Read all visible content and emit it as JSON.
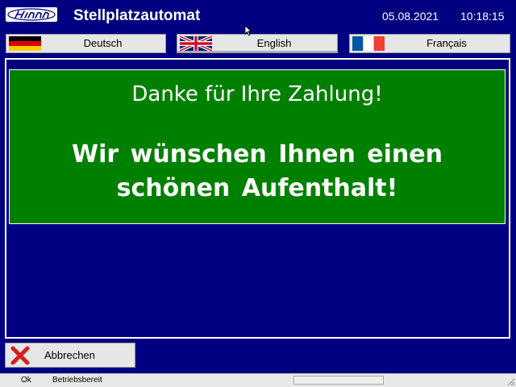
{
  "header": {
    "logo_text": "Hinn",
    "title": "Stellplatzautomat",
    "date": "05.08.2021",
    "time": "10:18:15"
  },
  "languages": [
    {
      "label": "Deutsch",
      "flag": "germany-flag-icon"
    },
    {
      "label": "English",
      "flag": "uk-flag-icon",
      "selected": true
    },
    {
      "label": "Français",
      "flag": "france-flag-icon"
    }
  ],
  "message": {
    "line1": "Danke für Ihre Zahlung!",
    "line2a": "Wir wünschen Ihnen einen",
    "line2b": "schönen Aufenthalt!"
  },
  "actions": {
    "cancel_label": "Abbrechen",
    "cancel_icon": "red-x-icon"
  },
  "status": {
    "ok": "Ok",
    "text": "Betriebsbereit"
  },
  "colors": {
    "background": "#000080",
    "message_box": "#008000",
    "button": "#e6e6e6",
    "cancel_x": "#d42020"
  }
}
